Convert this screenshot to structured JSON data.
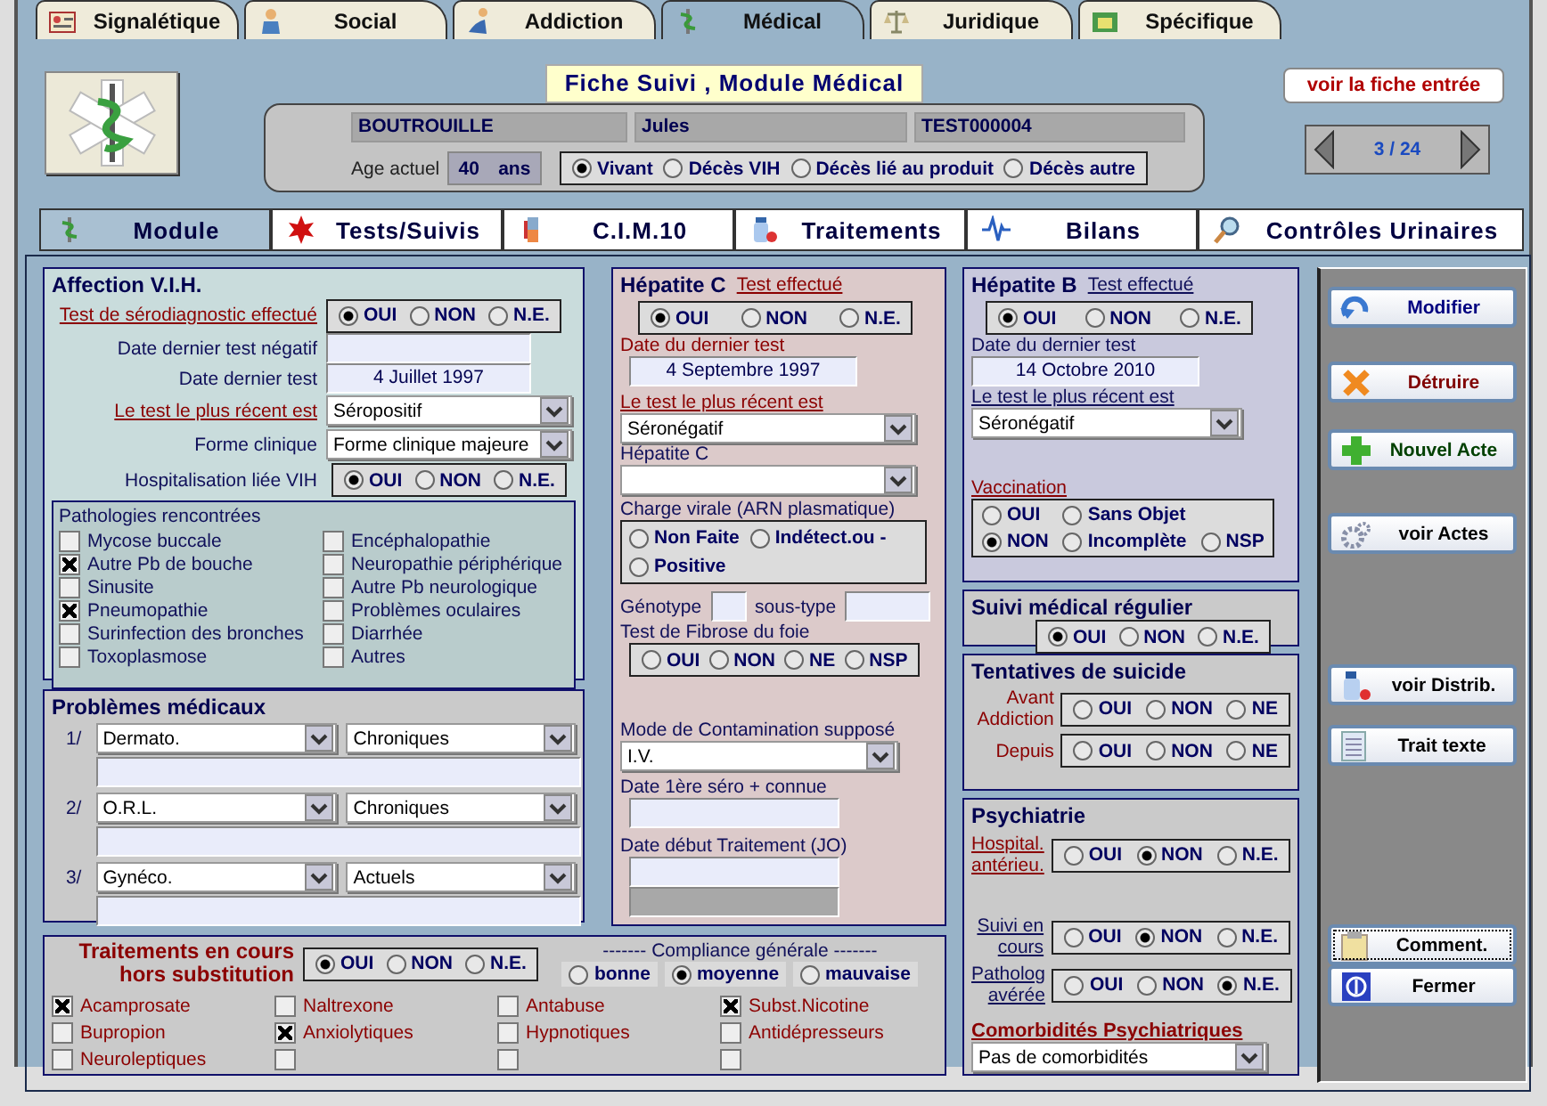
{
  "main_tabs": [
    {
      "label": "Signalétique",
      "selected": false
    },
    {
      "label": "Social",
      "selected": false
    },
    {
      "label": "Addiction",
      "selected": false
    },
    {
      "label": "Médical",
      "selected": true
    },
    {
      "label": "Juridique",
      "selected": false
    },
    {
      "label": "Spécifique",
      "selected": false
    }
  ],
  "header": {
    "title": "Fiche Suivi , Module Médical",
    "entry_button": "voir la fiche entrée",
    "record_position": "3 / 24"
  },
  "patient": {
    "last_name": "BOUTROUILLE",
    "first_name": "Jules",
    "code": "TEST000004",
    "age_label": "Age actuel",
    "age": "40",
    "age_unit": "ans",
    "status": [
      {
        "label": "Vivant",
        "selected": true
      },
      {
        "label": "Décès VIH",
        "selected": false
      },
      {
        "label": "Décès lié au produit",
        "selected": false
      },
      {
        "label": "Décès autre",
        "selected": false
      }
    ]
  },
  "module_tabs": [
    {
      "label": "Module",
      "selected": true
    },
    {
      "label": "Tests/Suivis",
      "selected": false
    },
    {
      "label": "C.I.M.10",
      "selected": false
    },
    {
      "label": "Traitements",
      "selected": false
    },
    {
      "label": "Bilans",
      "selected": false
    },
    {
      "label": "Contrôles Urinaires",
      "selected": false
    }
  ],
  "vih": {
    "title": "Affection V.I.H.",
    "test_label": "Test de sérodiagnostic effectué",
    "test_options": [
      {
        "label": "OUI",
        "selected": true
      },
      {
        "label": "NON",
        "selected": false
      },
      {
        "label": "N.E.",
        "selected": false
      }
    ],
    "last_negative_label": "Date dernier test négatif",
    "last_test_label": "Date dernier test",
    "last_test_value": "4 Juillet 1997",
    "recent_label": "Le test le plus récent est",
    "recent_value": "Séropositif",
    "clinical_label": "Forme clinique",
    "clinical_value": "Forme clinique majeure",
    "hosp_label": "Hospitalisation liée VIH",
    "hosp_options": [
      {
        "label": "OUI",
        "selected": true
      },
      {
        "label": "NON",
        "selected": false
      },
      {
        "label": "N.E.",
        "selected": false
      }
    ],
    "pathologies_title": "Pathologies rencontrées",
    "pathologies": [
      {
        "label": "Mycose buccale",
        "checked": false
      },
      {
        "label": "Encéphalopathie",
        "checked": false
      },
      {
        "label": "Autre Pb de bouche",
        "checked": true
      },
      {
        "label": "Neuropathie périphérique",
        "checked": false
      },
      {
        "label": "Sinusite",
        "checked": false
      },
      {
        "label": "Autre Pb neurologique",
        "checked": false
      },
      {
        "label": "Pneumopathie",
        "checked": true
      },
      {
        "label": "Problèmes oculaires",
        "checked": false
      },
      {
        "label": "Surinfection des bronches",
        "checked": false
      },
      {
        "label": "Diarrhée",
        "checked": false
      },
      {
        "label": "Toxoplasmose",
        "checked": false
      },
      {
        "label": "Autres",
        "checked": false
      }
    ]
  },
  "medical_problems": {
    "title": "Problèmes médicaux",
    "rows": [
      {
        "number": "1/",
        "category": "Dermato.",
        "duration": "Chroniques"
      },
      {
        "number": "2/",
        "category": "O.R.L.",
        "duration": "Chroniques"
      },
      {
        "number": "3/",
        "category": "Gynéco.",
        "duration": "Actuels"
      }
    ]
  },
  "hepatitis_c": {
    "title": "Hépatite C",
    "test_label": "Test effectué",
    "test_options": [
      {
        "label": "OUI",
        "selected": true
      },
      {
        "label": "NON",
        "selected": false
      },
      {
        "label": "N.E.",
        "selected": false
      }
    ],
    "date_label": "Date du dernier test",
    "date": "4 Septembre 1997",
    "recent_label": "Le test le plus récent est",
    "recent_value": "Séronégatif",
    "hepc_label": "Hépatite C",
    "viral_load_label": "Charge virale (ARN plasmatique)",
    "viral_load_options": [
      {
        "label": "Non Faite",
        "selected": false
      },
      {
        "label": "Indétect.ou -",
        "selected": false
      },
      {
        "label": "Positive",
        "selected": false
      }
    ],
    "genotype_label": "Génotype",
    "subtype_label": "sous-type",
    "fibrosis_label": "Test de Fibrose du foie",
    "fibrosis_options": [
      {
        "label": "OUI",
        "selected": false
      },
      {
        "label": "NON",
        "selected": false
      },
      {
        "label": "NE",
        "selected": false
      },
      {
        "label": "NSP",
        "selected": false
      }
    ],
    "contamination_label": "Mode de Contamination supposé",
    "contamination_value": "I.V.",
    "first_sero_label": "Date 1ère séro + connue",
    "treatment_start_label": "Date début Traitement (JO)"
  },
  "hepatitis_b": {
    "title": "Hépatite B",
    "test_label": "Test effectué",
    "test_options": [
      {
        "label": "OUI",
        "selected": true
      },
      {
        "label": "NON",
        "selected": false
      },
      {
        "label": "N.E.",
        "selected": false
      }
    ],
    "date_label": "Date du dernier test",
    "date": "14 Octobre 2010",
    "recent_label": "Le test le plus récent est",
    "recent_value": "Séronégatif",
    "vaccination_label": "Vaccination",
    "vaccination_options": [
      {
        "label": "OUI",
        "selected": false
      },
      {
        "label": "Sans Objet",
        "selected": false
      },
      {
        "label": "NON",
        "selected": true
      },
      {
        "label": "Incomplète",
        "selected": false
      },
      {
        "label": "NSP",
        "selected": false
      }
    ]
  },
  "regular_followup": {
    "title": "Suivi médical régulier",
    "options": [
      {
        "label": "OUI",
        "selected": true
      },
      {
        "label": "NON",
        "selected": false
      },
      {
        "label": "N.E.",
        "selected": false
      }
    ]
  },
  "suicide": {
    "title": "Tentatives de suicide",
    "rows": [
      {
        "label": "Avant Addiction",
        "options": [
          {
            "label": "OUI",
            "selected": false
          },
          {
            "label": "NON",
            "selected": false
          },
          {
            "label": "NE",
            "selected": false
          }
        ]
      },
      {
        "label": "Depuis",
        "options": [
          {
            "label": "OUI",
            "selected": false
          },
          {
            "label": "NON",
            "selected": false
          },
          {
            "label": "NE",
            "selected": false
          }
        ]
      }
    ]
  },
  "psychiatry": {
    "title": "Psychiatrie",
    "rows": [
      {
        "label": "Hospital. antérieu.",
        "options": [
          {
            "label": "OUI",
            "selected": false
          },
          {
            "label": "NON",
            "selected": true
          },
          {
            "label": "N.E.",
            "selected": false
          }
        ]
      },
      {
        "label": "Suivi en cours",
        "options": [
          {
            "label": "OUI",
            "selected": false
          },
          {
            "label": "NON",
            "selected": true
          },
          {
            "label": "N.E.",
            "selected": false
          }
        ]
      },
      {
        "label": "Patholog avérée",
        "options": [
          {
            "label": "OUI",
            "selected": false
          },
          {
            "label": "NON",
            "selected": false
          },
          {
            "label": "N.E.",
            "selected": true
          }
        ]
      }
    ],
    "comorbidity_label": "Comorbidités Psychiatriques",
    "comorbidity_value": "Pas de comorbidités"
  },
  "treatments": {
    "title": "Traitements en cours hors substitution",
    "options": [
      {
        "label": "OUI",
        "selected": true
      },
      {
        "label": "NON",
        "selected": false
      },
      {
        "label": "N.E.",
        "selected": false
      }
    ],
    "compliance_label": "------- Compliance générale -------",
    "compliance_options": [
      {
        "label": "bonne",
        "selected": false
      },
      {
        "label": "moyenne",
        "selected": true
      },
      {
        "label": "mauvaise",
        "selected": false
      }
    ],
    "drugs": [
      {
        "label": "Acamprosate",
        "checked": true
      },
      {
        "label": "Naltrexone",
        "checked": false
      },
      {
        "label": "Antabuse",
        "checked": false
      },
      {
        "label": "Subst.Nicotine",
        "checked": true
      },
      {
        "label": "Bupropion",
        "checked": false
      },
      {
        "label": "Anxiolytiques",
        "checked": true
      },
      {
        "label": "Hypnotiques",
        "checked": false
      },
      {
        "label": "Antidépresseurs",
        "checked": false
      },
      {
        "label": "Neuroleptiques",
        "checked": false
      },
      {
        "checked": false
      },
      {
        "checked": false
      },
      {
        "checked": false
      }
    ]
  },
  "actions": [
    {
      "label": "Modifier",
      "kind": "modify"
    },
    {
      "label": "Détruire",
      "kind": "delete"
    },
    {
      "label": "Nouvel Acte",
      "kind": "new"
    },
    {
      "label": "voir Actes",
      "kind": "acts"
    },
    {
      "label": "voir Distrib.",
      "kind": "distrib"
    },
    {
      "label": "Trait texte",
      "kind": "text"
    },
    {
      "label": "Comment.",
      "kind": "comment"
    },
    {
      "label": "Fermer",
      "kind": "close"
    }
  ]
}
